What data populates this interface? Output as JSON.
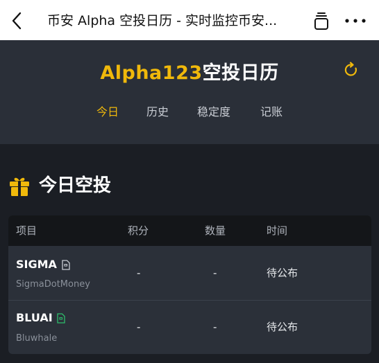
{
  "browser": {
    "title": "币安 Alpha 空投日历 - 实时监控币安..."
  },
  "header": {
    "brand_prefix": "Alpha123",
    "brand_suffix": "空投日历",
    "nav": [
      {
        "label": "今日",
        "active": true
      },
      {
        "label": "历史",
        "active": false
      },
      {
        "label": "稳定度",
        "active": false
      },
      {
        "label": "记账",
        "active": false
      }
    ]
  },
  "section": {
    "title": "今日空投"
  },
  "table": {
    "columns": [
      "项目",
      "积分",
      "数量",
      "时间"
    ],
    "rows": [
      {
        "name": "SIGMA",
        "subtitle": "SigmaDotMoney",
        "points": "-",
        "quantity": "-",
        "time": "待公布",
        "doc_icon_color": "#c9cdd4"
      },
      {
        "name": "BLUAI",
        "subtitle": "Bluwhale",
        "points": "-",
        "quantity": "-",
        "time": "待公布",
        "doc_icon_color": "#2ebd6b"
      }
    ]
  },
  "colors": {
    "accent": "#f0b90b",
    "header_bg": "#2a2f38",
    "page_bg": "#1b1e24"
  },
  "icons": [
    "back-chevron-icon",
    "tabs-icon",
    "more-icon",
    "refresh-icon",
    "gift-icon",
    "document-icon"
  ]
}
